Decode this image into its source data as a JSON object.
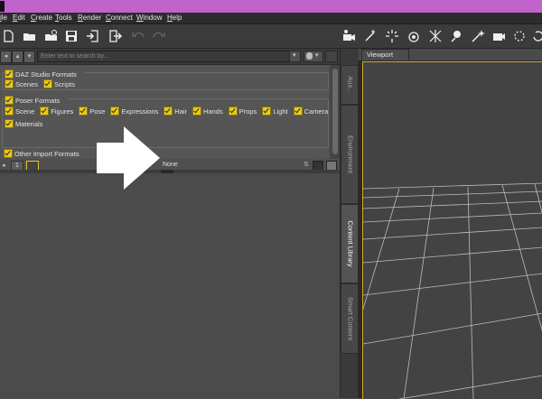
{
  "menu": [
    "ile",
    "Edit",
    "Create",
    "Tools",
    "Render",
    "Connect",
    "Window",
    "Help"
  ],
  "toolbar": {
    "left_icons": [
      "new-file-icon",
      "open-folder-icon",
      "open-recent-icon",
      "save-icon",
      "import-icon",
      "export-icon",
      "undo-icon",
      "redo-icon"
    ],
    "right_icons": [
      "figure-camera-icon",
      "light-tool-icon",
      "spot-light-icon",
      "point-light-icon",
      "distant-light-icon",
      "bulb-icon",
      "sparkle-wand-icon",
      "camera-icon",
      "node-icon",
      "rotate-icon"
    ]
  },
  "search": {
    "placeholder": "Enter text to search by..."
  },
  "formats": {
    "daz_group": "DAZ Studio Formats",
    "daz_items": [
      "Scenes",
      "Scripts"
    ],
    "poser_group": "Poser Formats",
    "poser_items": [
      "Scene",
      "Figures",
      "Pose",
      "Expressions",
      "Hair",
      "Hands",
      "Props",
      "Light",
      "Camera"
    ],
    "poser_items_row2": [
      "Materials"
    ],
    "other_label": "Other Import Formats"
  },
  "pager": {
    "page": "1",
    "status": "None"
  },
  "side_tabs": [
    "Aux...",
    "Environment",
    "Content Library",
    "Smart Content"
  ],
  "viewport": {
    "tab_label": "Viewport"
  },
  "colors": {
    "titlebar": "#c063cc",
    "checkbox": "#e8c91c",
    "viewport_border": "#d6a820"
  }
}
